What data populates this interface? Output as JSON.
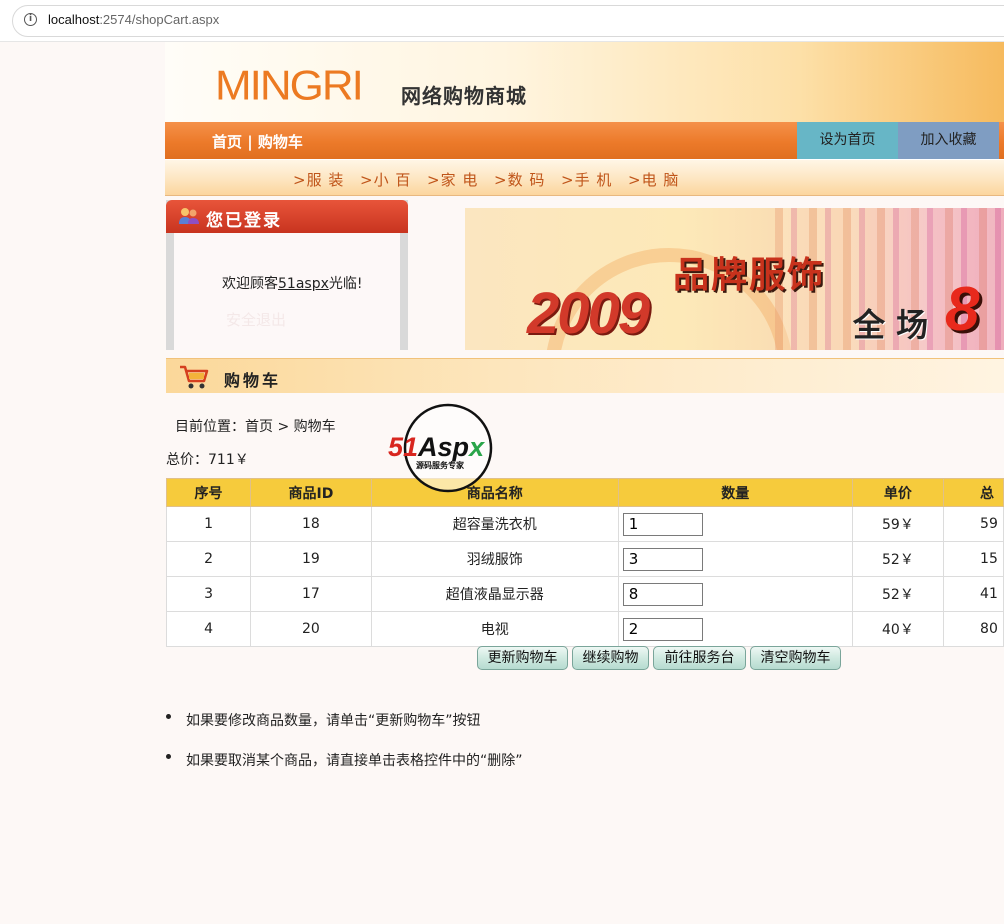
{
  "browser": {
    "url_host": "localhost",
    "url_path": ":2574/shopCart.aspx"
  },
  "header": {
    "logo": "MINGRI",
    "subtitle": "网络购物商城"
  },
  "nav": {
    "links": "首页 | 购物车",
    "set_home": "设为首页",
    "add_favorite": "加入收藏"
  },
  "categories": [
    ">服 装",
    ">小 百",
    ">家 电",
    ">数 码",
    ">手 机",
    ">电 脑"
  ],
  "login": {
    "title": "您已登录",
    "welcome_prefix": "欢迎顾客",
    "username": "51aspx",
    "welcome_suffix": "光临!",
    "logout": "安全退出"
  },
  "promo": {
    "year": "2009",
    "brand": "品牌服饰",
    "all": "全 场",
    "discount": "8"
  },
  "cart": {
    "title": "购物车",
    "breadcrumb": "目前位置：首页 > 购物车",
    "total": "总价：711￥",
    "columns": [
      "序号",
      "商品ID",
      "商品名称",
      "数量",
      "单价",
      "总"
    ],
    "rows": [
      {
        "no": "1",
        "id": "18",
        "name": "超容量洗衣机",
        "qty": "1",
        "price": "59￥",
        "subtotal": "59"
      },
      {
        "no": "2",
        "id": "19",
        "name": "羽绒服饰",
        "qty": "3",
        "price": "52￥",
        "subtotal": "15"
      },
      {
        "no": "3",
        "id": "17",
        "name": "超值液晶显示器",
        "qty": "8",
        "price": "52￥",
        "subtotal": "41"
      },
      {
        "no": "4",
        "id": "20",
        "name": "电视",
        "qty": "2",
        "price": "40￥",
        "subtotal": "80"
      }
    ],
    "buttons": {
      "update": "更新购物车",
      "continue": "继续购物",
      "checkout": "前往服务台",
      "clear": "清空购物车"
    }
  },
  "watermark": {
    "brand": "51Aspx",
    "tagline": "源码服务专家"
  },
  "notes": [
    "如果要修改商品数量，请单击“更新购物车”按钮",
    "如果要取消某个商品，请直接单击表格控件中的“删除”"
  ],
  "colors": {
    "nav_orange": "#ec7a2a",
    "table_header": "#f6cb3c",
    "login_red": "#c8341f"
  }
}
